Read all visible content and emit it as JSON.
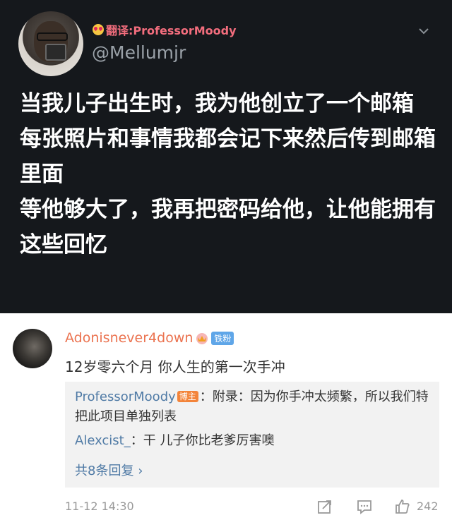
{
  "tweet": {
    "translator": "翻译:ProfessorMoody",
    "handle": "@Mellumjr",
    "lines": [
      "当我儿子出生时，我为他创立了一个邮箱",
      "每张照片和事情我都会记下来然后传到邮箱里面",
      "等他够大了，我再把密码给他，让他能拥有这些回忆"
    ]
  },
  "comment": {
    "username": "Adonisnever4down",
    "badge": "铁粉",
    "text": "12岁零六个月 你人生的第一次手冲",
    "replies": [
      {
        "user": "ProfessorMoody",
        "badge": "博主",
        "text": "：附录：因为你手冲太频繁，所以我们特把此项目单独列表"
      },
      {
        "user": "Alexcist_",
        "text": "：干 儿子你比老爹厉害噢"
      }
    ],
    "more": "共8条回复",
    "time": "11-12 14:30",
    "likes": "242"
  },
  "colors": {
    "dark_bg": "#15181c",
    "name_orange": "#eb7350",
    "link_blue": "#4f7aa5"
  },
  "icons": [
    "chevron-down-icon",
    "crown-icon",
    "share-icon",
    "comment-icon",
    "like-icon",
    "chevron-right-icon"
  ]
}
